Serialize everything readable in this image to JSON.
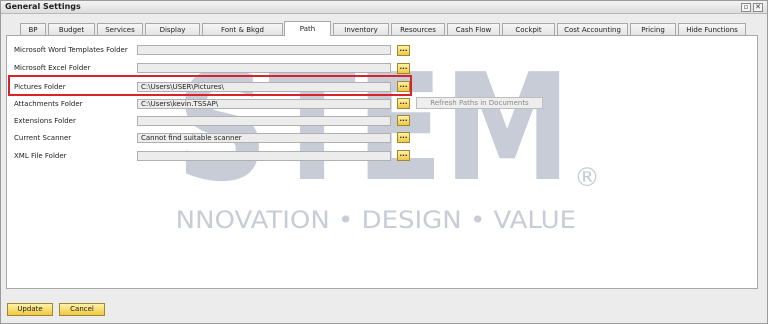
{
  "window": {
    "title": "General Settings"
  },
  "tabs": [
    {
      "label": "BP"
    },
    {
      "label": "Budget"
    },
    {
      "label": "Services"
    },
    {
      "label": "Display"
    },
    {
      "label": "Font & Bkgd"
    },
    {
      "label": "Path",
      "active": true
    },
    {
      "label": "Inventory"
    },
    {
      "label": "Resources"
    },
    {
      "label": "Cash Flow"
    },
    {
      "label": "Cockpit"
    },
    {
      "label": "Cost Accounting"
    },
    {
      "label": "Pricing"
    },
    {
      "label": "Hide Functions"
    }
  ],
  "paths": {
    "word_templates": {
      "label": "Microsoft Word Templates Folder",
      "value": ""
    },
    "excel": {
      "label": "Microsoft Excel Folder",
      "value": ""
    },
    "pictures": {
      "label": "Pictures Folder",
      "value": "C:\\Users\\USER\\Pictures\\"
    },
    "attachments": {
      "label": "Attachments Folder",
      "value": "C:\\Users\\kevin.TSSAP\\"
    },
    "extensions": {
      "label": "Extensions Folder",
      "value": ""
    },
    "scanner": {
      "label": "Current Scanner",
      "value": "Cannot find suitable scanner"
    },
    "xml": {
      "label": "XML File Folder",
      "value": ""
    }
  },
  "browse_label": "...",
  "refresh_label": "Refresh Paths in Documents",
  "watermark": {
    "logo": "STEM",
    "tagline": "INNOVATION • DESIGN • VALUE",
    "mark": "®"
  },
  "footer": {
    "update_label": "Update",
    "cancel_label": "Cancel"
  },
  "colors": {
    "highlight": "#d8232a",
    "button_accent": "#f0c840",
    "watermark": "#9aa3b8"
  }
}
